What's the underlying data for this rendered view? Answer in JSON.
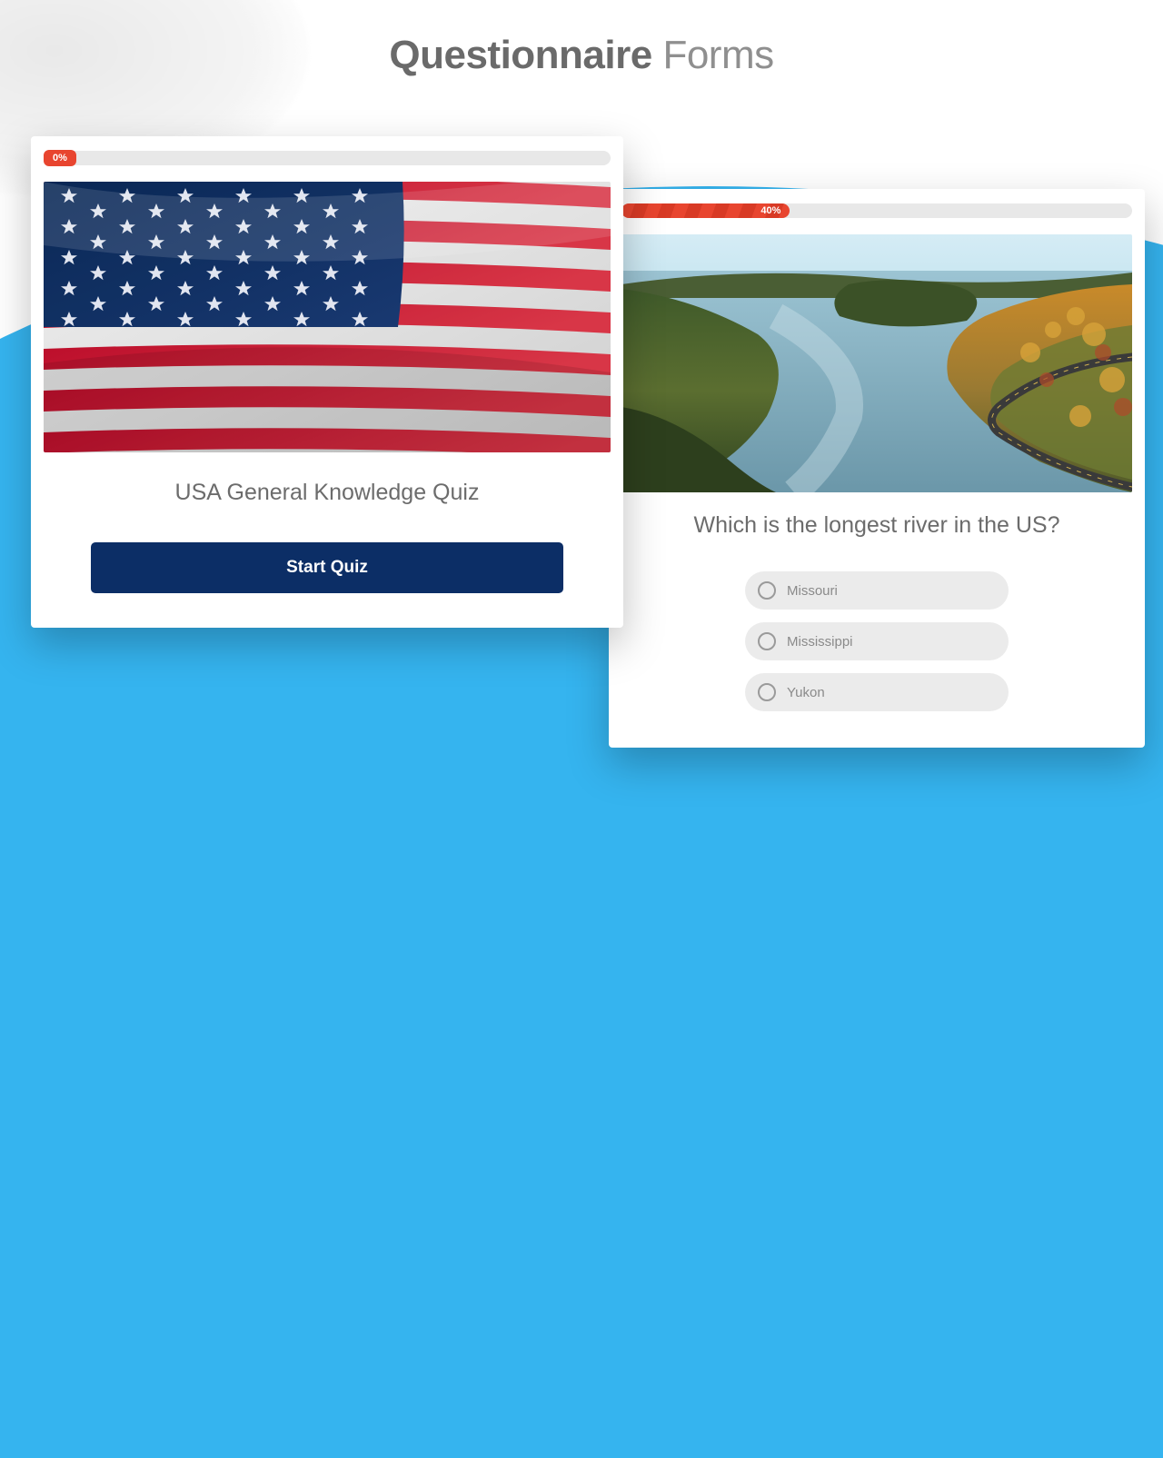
{
  "title": {
    "bold": "Questionnaire",
    "light": "Forms"
  },
  "card1": {
    "progress_percent": "0%",
    "quiz_title": "USA General Knowledge Quiz",
    "start_label": "Start Quiz"
  },
  "card2": {
    "progress_percent": "40%",
    "question": "Which is the longest river in the US?",
    "options": [
      "Missouri",
      "Mississippi",
      "Yukon"
    ]
  },
  "colors": {
    "accent_blue": "#35b4ef",
    "button_navy": "#0c2e66",
    "progress_red": "#e8452f"
  }
}
